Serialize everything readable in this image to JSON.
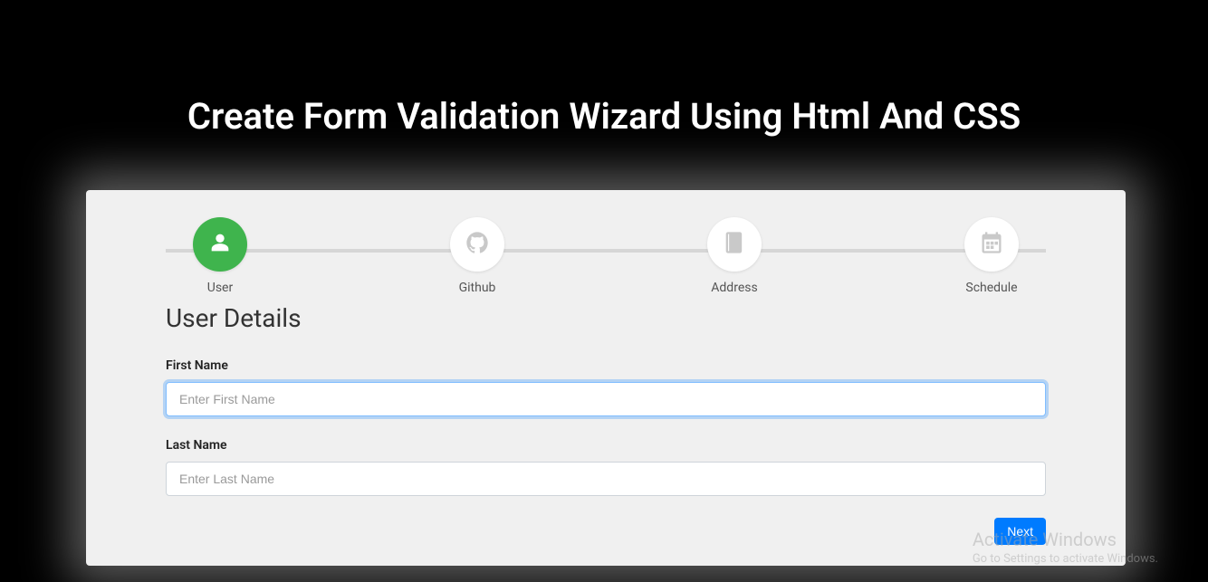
{
  "page": {
    "title": "Create Form Validation Wizard Using Html And CSS"
  },
  "wizard": {
    "steps": [
      {
        "label": "User"
      },
      {
        "label": "Github"
      },
      {
        "label": "Address"
      },
      {
        "label": "Schedule"
      }
    ]
  },
  "form": {
    "section_title": "User Details",
    "first_name": {
      "label": "First Name",
      "placeholder": "Enter First Name",
      "value": ""
    },
    "last_name": {
      "label": "Last Name",
      "placeholder": "Enter Last Name",
      "value": ""
    },
    "next_label": "Next"
  },
  "watermark": {
    "title": "Activate Windows",
    "subtitle": "Go to Settings to activate Windows."
  }
}
